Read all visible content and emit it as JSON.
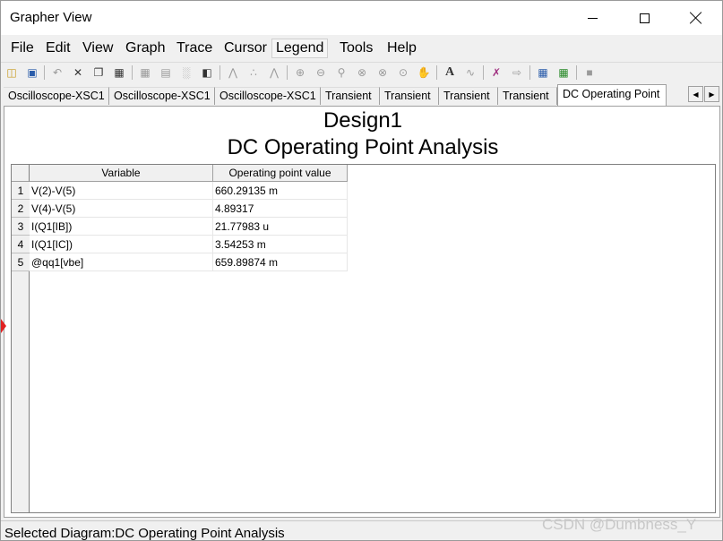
{
  "window": {
    "title": "Grapher View"
  },
  "menu": [
    "File",
    "Edit",
    "View",
    "Graph",
    "Trace",
    "Cursor",
    "Legend",
    "Tools",
    "Help"
  ],
  "menu_active": "Legend",
  "toolbar_icons": [
    "open-folder-icon",
    "save-icon",
    "undo-icon",
    "cut-icon",
    "copy-icon",
    "paste-icon",
    "grid-icon",
    "legend-table-icon",
    "cursor-bars-icon",
    "overlay-icon",
    "line-plot-icon",
    "scatter-plot-icon",
    "line-markers-icon",
    "zoom-in-icon",
    "zoom-out-icon",
    "zoom-area-icon",
    "zoom-x-icon",
    "zoom-y-icon",
    "zoom-fit-icon",
    "pan-hand-icon",
    "text-icon",
    "signal-icon",
    "cross-traces-icon",
    "transfer-icon",
    "export-icon",
    "export-excel-icon",
    "stop-icon"
  ],
  "tabs": [
    "Oscilloscope-XSC1",
    "Oscilloscope-XSC1",
    "Oscilloscope-XSC1",
    "Transient",
    "Transient",
    "Transient",
    "Transient",
    "DC Operating Point"
  ],
  "active_tab_index": 7,
  "diagram": {
    "design_title": "Design1",
    "analysis_title": "DC Operating Point Analysis",
    "columns": [
      "Variable",
      "Operating point value"
    ],
    "rows": [
      {
        "num": "1",
        "variable": "V(2)-V(5)",
        "value": "660.29135 m"
      },
      {
        "num": "2",
        "variable": "V(4)-V(5)",
        "value": "4.89317"
      },
      {
        "num": "3",
        "variable": "I(Q1[IB])",
        "value": "21.77983 u"
      },
      {
        "num": "4",
        "variable": "I(Q1[IC])",
        "value": "3.54253 m"
      },
      {
        "num": "5",
        "variable": "@qq1[vbe]",
        "value": "659.89874 m"
      }
    ]
  },
  "status": {
    "text": "Selected Diagram:DC Operating Point Analysis"
  },
  "watermark": "CSDN @Dumbness_Y",
  "colors": {
    "marker": "#e02020",
    "active_tab": "#ffffff",
    "chrome": "#f0f0f0"
  }
}
